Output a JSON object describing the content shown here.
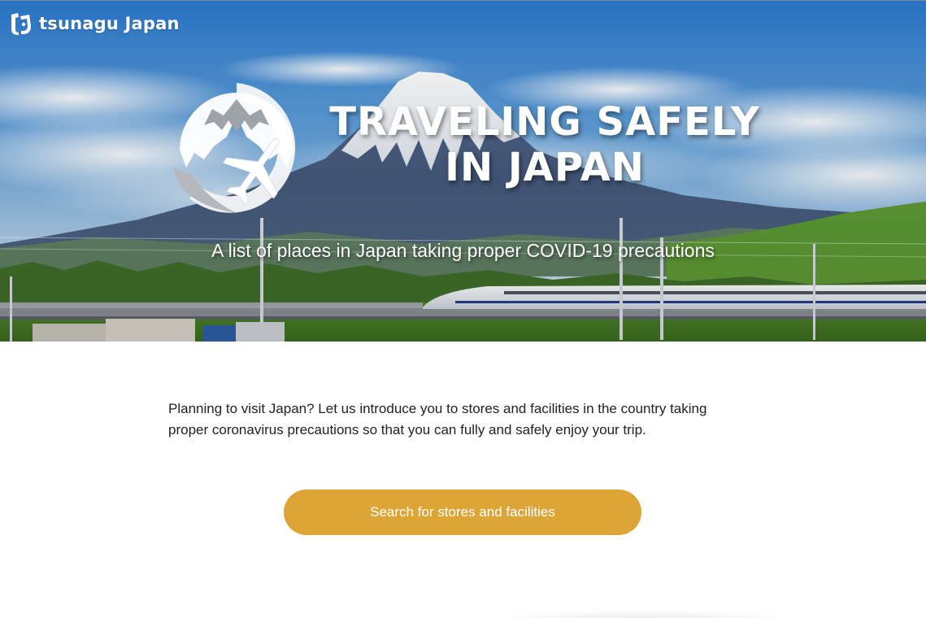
{
  "header": {
    "logo_text": "tsunagu Japan"
  },
  "hero": {
    "title_line1": "TRAVELING SAFELY",
    "title_line2": "IN JAPAN",
    "subtitle": "A list of places in Japan taking proper COVID-19 precautions"
  },
  "intro": {
    "line1": "Planning to visit Japan? Let us introduce you to stores and facilities in the country taking",
    "line2": "proper coronavirus precautions so that you can fully and safely enjoy your trip."
  },
  "cta": {
    "label": "Search for stores and facilities"
  },
  "icons": {
    "logo_mark": "tsunagu-logo-icon",
    "emblem": "mount-fuji-airplane-emblem-icon"
  },
  "colors": {
    "cta_background": "#dca535",
    "cta_text": "#ffffff",
    "body_text": "#222222",
    "hero_text": "#ffffff"
  }
}
